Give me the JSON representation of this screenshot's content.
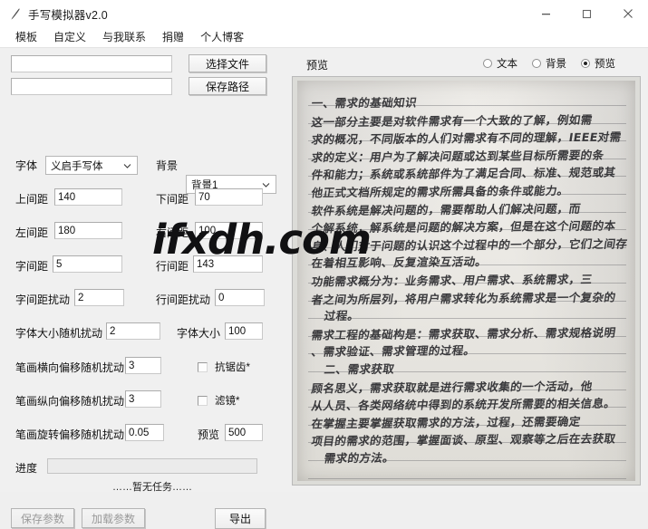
{
  "window": {
    "title": "手写模拟器v2.0",
    "icon": "pen-icon",
    "minimize_label": "—",
    "maximize_label": "❐",
    "close_label": "✕"
  },
  "menubar": {
    "items": [
      {
        "label": "模板",
        "name": "menu-template"
      },
      {
        "label": "自定义",
        "name": "menu-custom"
      },
      {
        "label": "与我联系",
        "name": "menu-contact"
      },
      {
        "label": "捐赠",
        "name": "menu-donate"
      },
      {
        "label": "个人博客",
        "name": "menu-blog"
      }
    ]
  },
  "left_panel": {
    "file_path_input": {
      "value": "",
      "placeholder": ""
    },
    "save_path_input": {
      "value": "",
      "placeholder": ""
    },
    "select_file_button": "选择文件",
    "save_path_button": "保存路径",
    "font_label": "字体",
    "font_value": "义启手写体",
    "background_label": "背景",
    "background_value": "背景1",
    "fields": [
      {
        "label": "上间距",
        "value": "140"
      },
      {
        "label": "下间距",
        "value": "70"
      },
      {
        "label": "左间距",
        "value": "180"
      },
      {
        "label": "右间距",
        "value": "100"
      },
      {
        "label": "字间距",
        "value": "5"
      },
      {
        "label": "行间距",
        "value": "143"
      },
      {
        "label": "字间距扰动",
        "value": "2"
      },
      {
        "label": "行间距扰动",
        "value": "0"
      },
      {
        "label": "字体大小随机扰动",
        "value": "2"
      },
      {
        "label": "字体大小",
        "value": "100"
      },
      {
        "label": "笔画横向偏移随机扰动",
        "value": "3"
      },
      {
        "label": "笔画纵向偏移随机扰动",
        "value": "3"
      },
      {
        "label": "笔画旋转偏移随机扰动",
        "value": "0.05"
      },
      {
        "label": "预览",
        "value": "500"
      }
    ],
    "checkboxes": [
      {
        "label": "抗锯齿*",
        "checked": false
      },
      {
        "label": "滤镜*",
        "checked": false
      }
    ],
    "progress_label": "进度",
    "progress_value": 0,
    "task_status": "……暂无任务……",
    "save_params_button": "保存参数",
    "load_params_button": "加载参数",
    "export_button": "导出"
  },
  "right_panel": {
    "preview_label": "预览",
    "radios": [
      {
        "label": "文本",
        "selected": false
      },
      {
        "label": "背景",
        "selected": false
      },
      {
        "label": "预览",
        "selected": true
      }
    ],
    "preview_content": {
      "kind": "handwriting-scan",
      "lines": [
        "一、需求的基础知识",
        "这一部分主要是对软件需求有一个大致的了解，例如需",
        "求的概况，不同版本的人们对需求有不同的理解，IEEE对需",
        "求的定义：用户为了解决问题或达到某些目标所需要的条",
        "件和能力；系统或系统部件为了满足合同、标准、规范或其",
        "他正式文档所规定的需求所需具备的条件或能力。",
        "软件系统是解决问题的，需要帮助人们解决问题，而",
        "个解系统，解系统是问题的解决方案，但是在这个问题的本",
        "身、人们对于问题的认识这个过程中的一个部分，它们之间存",
        "在着相互影响、反复渲染互活动。",
        "功能需求概分为：业务需求、用户需求、系统需求，三",
        "者之间为所层列，将用户需求转化为系统需求是一个复杂的",
        "过程。",
        "需求工程的基础构是：需求获取、需求分析、需求规格说明",
        "、需求验证、需求管理的过程。",
        "二、需求获取",
        "顾名思义，需求获取就是进行需求收集的一个活动，他",
        "从人员、各类网络统中得到的系统开发所需要的相关信息。",
        "在掌握主要掌握获取需求的方法，过程，还需要确定",
        "项目的需求的范围，掌握面谈、原型、观察等之后在去获取",
        "需求的方法。"
      ]
    }
  },
  "watermark": {
    "text": "ifxdh.com"
  },
  "colors": {
    "window_bg": "#f0f0f0",
    "titlebar_bg": "#ffffff",
    "field_bg": "#ffffff",
    "border": "#b4b4b4",
    "text": "#111111",
    "disabled_text": "#9a9a9a"
  }
}
